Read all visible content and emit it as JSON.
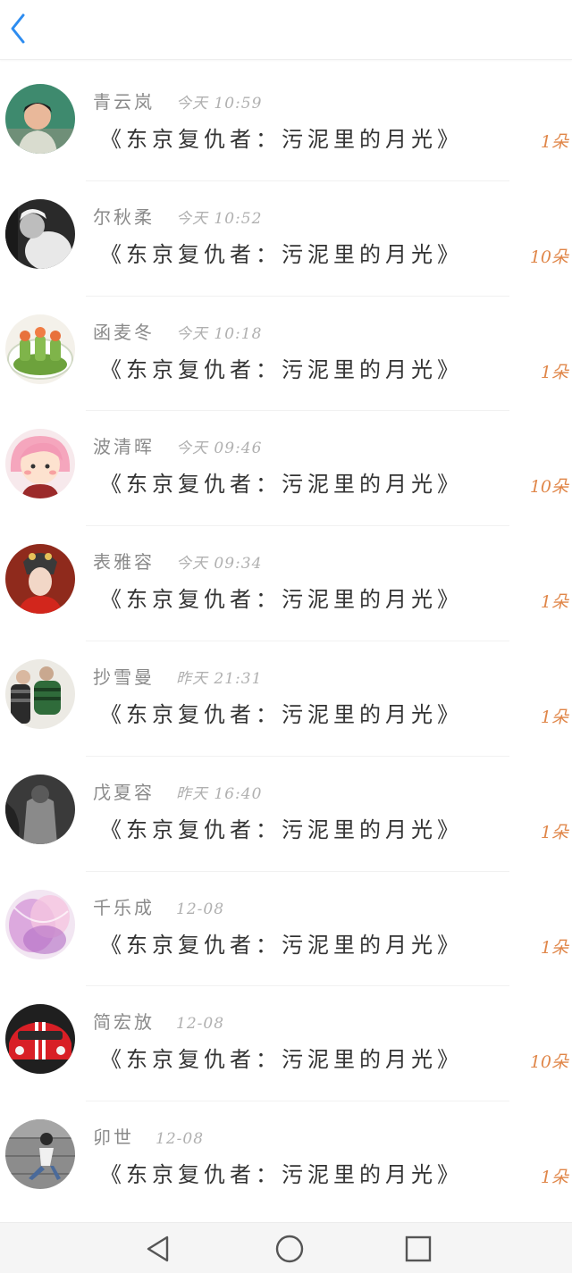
{
  "header": {
    "back_icon": "chevron-left-icon",
    "accent_color": "#2d8cf0"
  },
  "items": [
    {
      "name": "青云岚",
      "time": "今天 10:59",
      "title": "《东京复仇者：污泥里的月光》",
      "count": "1朵"
    },
    {
      "name": "尔秋柔",
      "time": "今天 10:52",
      "title": "《东京复仇者：污泥里的月光》",
      "count": "10朵"
    },
    {
      "name": "函麦冬",
      "time": "今天 10:18",
      "title": "《东京复仇者：污泥里的月光》",
      "count": "1朵"
    },
    {
      "name": "波清晖",
      "time": "今天 09:46",
      "title": "《东京复仇者：污泥里的月光》",
      "count": "10朵"
    },
    {
      "name": "表雅容",
      "time": "今天 09:34",
      "title": "《东京复仇者：污泥里的月光》",
      "count": "1朵"
    },
    {
      "name": "抄雪曼",
      "time": "昨天 21:31",
      "title": "《东京复仇者：污泥里的月光》",
      "count": "1朵"
    },
    {
      "name": "戊夏容",
      "time": "昨天 16:40",
      "title": "《东京复仇者：污泥里的月光》",
      "count": "1朵"
    },
    {
      "name": "千乐成",
      "time": "12-08",
      "title": "《东京复仇者：污泥里的月光》",
      "count": "1朵"
    },
    {
      "name": "简宏放",
      "time": "12-08",
      "title": "《东京复仇者：污泥里的月光》",
      "count": "10朵"
    },
    {
      "name": "卯世",
      "time": "12-08",
      "title": "《东京复仇者：污泥里的月光》",
      "count": "1朵"
    }
  ],
  "count_color": "#e0874a",
  "navbar": {
    "back_icon": "triangle-back-icon",
    "home_icon": "circle-home-icon",
    "recents_icon": "square-recents-icon"
  }
}
